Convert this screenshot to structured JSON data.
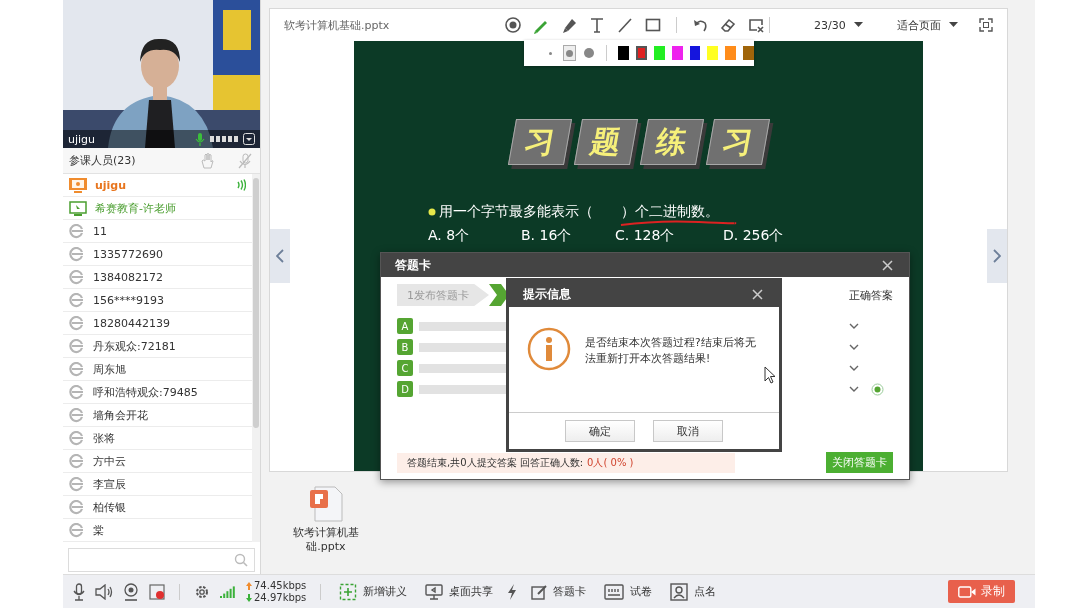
{
  "video": {
    "name": "ujigu"
  },
  "participants_header": {
    "title": "参课人员(23)"
  },
  "participants": [
    {
      "name": "ujigu",
      "kind": "presenter",
      "speaking": true
    },
    {
      "name": "希赛教育-许老师",
      "kind": "assistant",
      "speaking": false
    },
    {
      "name": "11",
      "kind": "viewer",
      "speaking": false
    },
    {
      "name": "1335772690",
      "kind": "viewer",
      "speaking": false
    },
    {
      "name": "1384082172",
      "kind": "viewer",
      "speaking": false
    },
    {
      "name": "156****9193",
      "kind": "viewer",
      "speaking": false
    },
    {
      "name": "18280442139",
      "kind": "viewer",
      "speaking": false
    },
    {
      "name": "丹东观众:72181",
      "kind": "viewer",
      "speaking": false
    },
    {
      "name": "周东旭",
      "kind": "viewer",
      "speaking": false
    },
    {
      "name": "呼和浩特观众:79485",
      "kind": "viewer",
      "speaking": false
    },
    {
      "name": "墙角会开花",
      "kind": "viewer",
      "speaking": false
    },
    {
      "name": "张将",
      "kind": "viewer",
      "speaking": false
    },
    {
      "name": "方中云",
      "kind": "viewer",
      "speaking": false
    },
    {
      "name": "李宣辰",
      "kind": "viewer",
      "speaking": false
    },
    {
      "name": "柏传银",
      "kind": "viewer",
      "speaking": false
    },
    {
      "name": "棠",
      "kind": "viewer",
      "speaking": false
    }
  ],
  "toolbar": {
    "filename": "软考计算机基础.pptx",
    "tools": [
      {
        "kind": "record",
        "selected": false
      },
      {
        "kind": "pen",
        "selected": true
      },
      {
        "kind": "highlighter",
        "selected": false
      },
      {
        "kind": "text",
        "selected": false
      },
      {
        "kind": "line",
        "selected": false
      },
      {
        "kind": "rectangle",
        "selected": false
      },
      {
        "kind": "undo",
        "selected": false
      },
      {
        "kind": "eraser",
        "selected": false
      },
      {
        "kind": "clear",
        "selected": false
      }
    ],
    "page": "23/30",
    "zoom": "适合页面"
  },
  "pen_palette": {
    "sizes": [
      {
        "kind": "small",
        "selected": false
      },
      {
        "kind": "medium",
        "selected": true
      },
      {
        "kind": "large",
        "selected": false
      }
    ],
    "colors": [
      {
        "color": "#000000",
        "selected": false
      },
      {
        "color": "#e02020",
        "selected": true
      },
      {
        "color": "#22ee22",
        "selected": false
      },
      {
        "color": "#ee22ee",
        "selected": false
      },
      {
        "color": "#1515dd",
        "selected": false
      },
      {
        "color": "#ffff22",
        "selected": false
      },
      {
        "color": "#ff8c1a",
        "selected": false
      },
      {
        "color": "#a0650a",
        "selected": false
      }
    ]
  },
  "slide": {
    "title_tiles": [
      "习",
      "题",
      "练",
      "习"
    ],
    "question": "用一个字节最多能表示（　　）个二进制数。",
    "options": [
      "A. 8个",
      "B. 16个",
      "C. 128个",
      "D. 256个"
    ]
  },
  "files": [
    {
      "name": "软考计算机基础.pptx"
    }
  ],
  "answer_card": {
    "title": "答题卡",
    "step": "1发布答题卡",
    "correct_header": "正确答案",
    "rows": [
      {
        "letter": "A",
        "correct": false
      },
      {
        "letter": "B",
        "correct": false
      },
      {
        "letter": "C",
        "correct": false
      },
      {
        "letter": "D",
        "correct": true
      }
    ],
    "status": "答题结束,共0人提交答案 回答正确人数:",
    "result": "0人( 0% )",
    "close_button": "关闭答题卡"
  },
  "prompt": {
    "title": "提示信息",
    "message": "是否结束本次答题过程?结束后将无法重新打开本次答题结果!",
    "buttons": [
      "确定",
      "取消"
    ]
  },
  "bottom_bar": {
    "upload_rate": "74.45kbps",
    "download_rate": "24.97kbps",
    "actions": [
      {
        "kind": "add",
        "label": "新增讲义"
      },
      {
        "kind": "screen",
        "label": "桌面共享"
      },
      {
        "kind": "flash"
      },
      {
        "kind": "card",
        "label": "答题卡"
      },
      {
        "kind": "paper",
        "label": "试卷"
      },
      {
        "kind": "rollcall",
        "label": "点名"
      }
    ],
    "record_button": "录制"
  }
}
